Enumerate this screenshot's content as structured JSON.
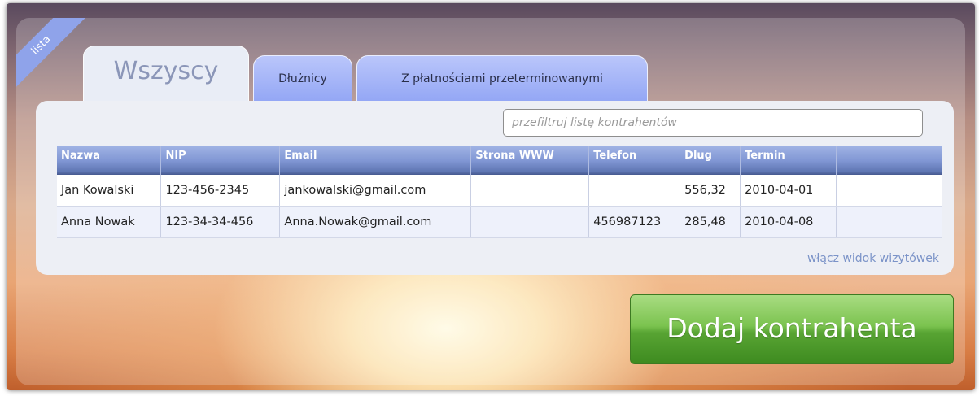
{
  "ribbon": {
    "label": "lista"
  },
  "tabs": [
    {
      "label": "Wszyscy"
    },
    {
      "label": "Dłużnicy"
    },
    {
      "label": "Z płatnościami przeterminowanymi"
    }
  ],
  "search": {
    "placeholder": "przefiltruj listę kontrahentów",
    "value": ""
  },
  "table": {
    "columns": [
      "Nazwa",
      "NIP",
      "Email",
      "Strona WWW",
      "Telefon",
      "Dlug",
      "Termin",
      ""
    ],
    "rows": [
      [
        "Jan Kowalski",
        "123-456-2345",
        "jankowalski@gmail.com",
        "",
        "",
        "556,32",
        "2010-04-01",
        ""
      ],
      [
        "Anna Nowak",
        "123-34-34-456",
        "Anna.Nowak@gmail.com",
        "",
        "456987123",
        "285,48",
        "2010-04-08",
        ""
      ]
    ]
  },
  "card_view_link": "włącz widok wizytówek",
  "add_button": "Dodaj kontrahenta",
  "colors": {
    "tab_active": "#e9edf6",
    "tab_inactive": "#a6b6f8",
    "header_blue": "#8197d4",
    "link": "#7b93c8",
    "button_green": "#58a433"
  }
}
